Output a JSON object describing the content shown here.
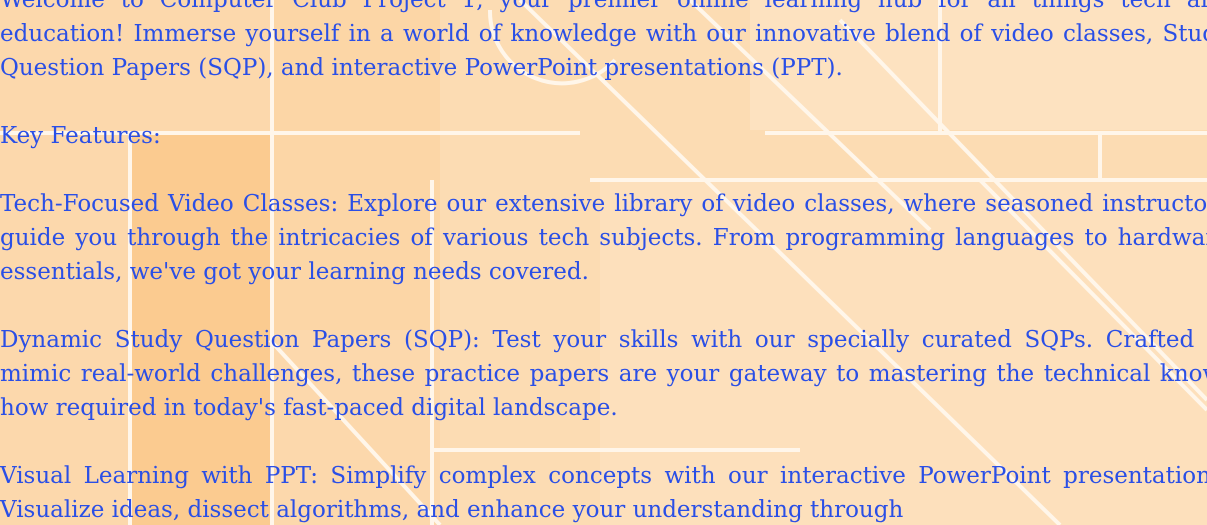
{
  "intro": "Welcome to Computer Club Project 1, your premier online learning hub for all things tech and education! Immerse yourself in a world of knowledge with our innovative blend of video classes, Study Question Papers (SQP), and interactive PowerPoint presentations (PPT).",
  "features_heading": "Key Features:",
  "features": [
    "Tech-Focused Video Classes: Explore our extensive library of video classes, where seasoned instructors guide you through the intricacies of various tech subjects. From programming languages to hardware essentials, we've got your learning needs covered.",
    "Dynamic Study Question Papers (SQP): Test your skills with our specially curated SQPs. Crafted to mimic real-world challenges, these practice papers are your gateway to mastering the technical know-how required in today's fast-paced digital landscape.",
    "Visual Learning with PPT: Simplify complex concepts with our interactive PowerPoint presentations. Visualize ideas, dissect algorithms, and enhance your understanding through"
  ],
  "colors": {
    "background": "#fcdcb3",
    "text": "#2a4fe6",
    "panel": "#fac98b",
    "lines": "#fff6ea"
  }
}
